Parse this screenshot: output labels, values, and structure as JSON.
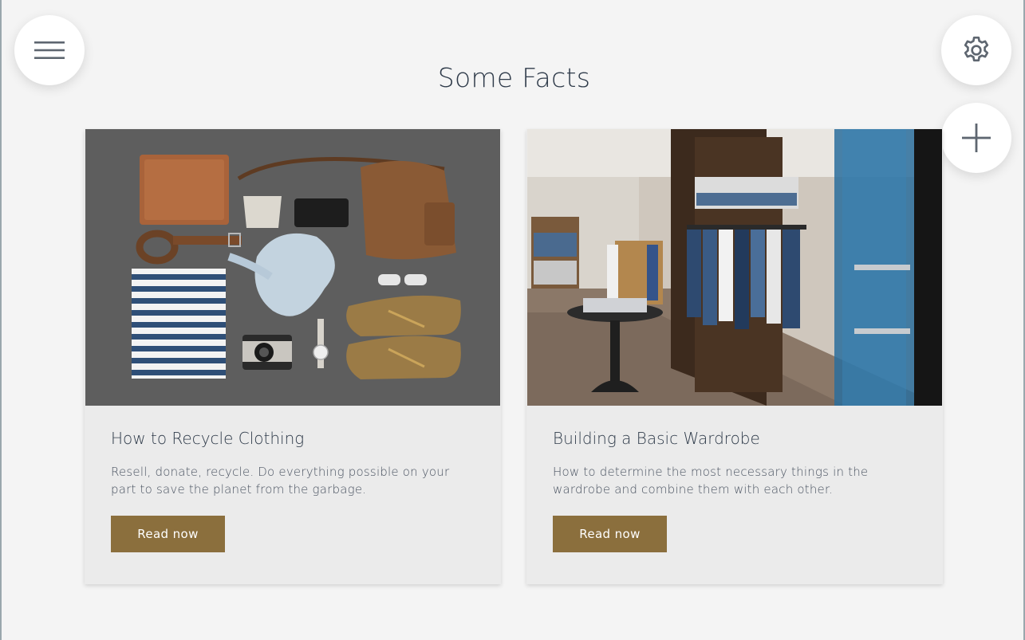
{
  "header": {
    "title": "Some Facts",
    "menu_icon": "hamburger-menu-icon",
    "settings_icon": "gear-icon",
    "add_icon": "plus-icon"
  },
  "cards": [
    {
      "title": "How to Recycle Clothing",
      "text": "Resell, donate, recycle. Do everything possible on your part to save the planet from the garbage.",
      "button_label": "Read now",
      "image": "flat-lay-clothing-accessories-photo"
    },
    {
      "title": "Building a Basic Wardrobe",
      "text": "How to determine the most necessary things in the wardrobe and combine them with each other.",
      "button_label": "Read now",
      "image": "clothing-store-interior-photo"
    }
  ],
  "colors": {
    "background": "#f4f4f4",
    "card": "#ebebeb",
    "button": "#8b6f3d",
    "text": "#2f3b4a"
  }
}
